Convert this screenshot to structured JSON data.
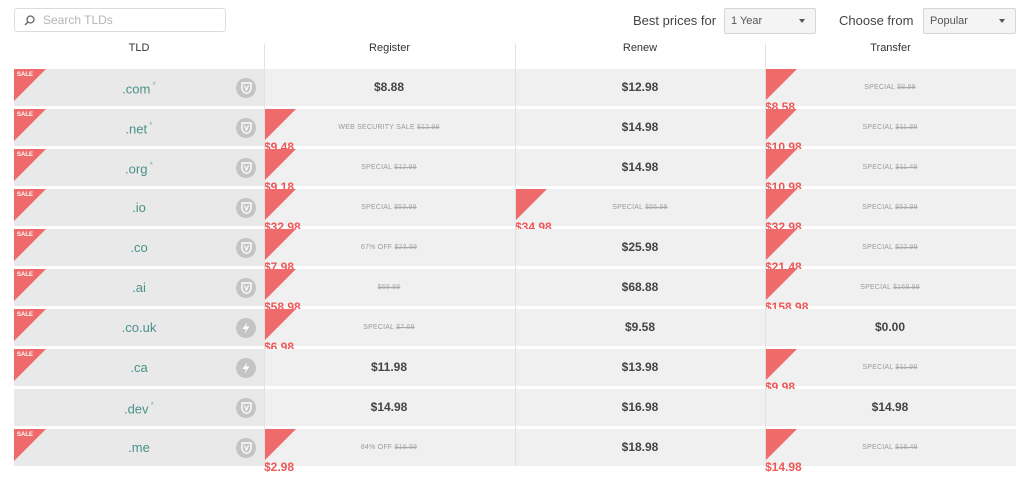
{
  "search": {
    "placeholder": "Search TLDs"
  },
  "controls": {
    "best_prices_label": "Best prices for",
    "term_value": "1 Year",
    "choose_from_label": "Choose from",
    "source_value": "Popular"
  },
  "table": {
    "headers": {
      "tld": "TLD",
      "register": "Register",
      "renew": "Renew",
      "transfer": "Transfer"
    },
    "sale_label": "SALE",
    "rows": [
      {
        "tld": ".com",
        "star": "*",
        "sale": true,
        "badge": "shield-icon",
        "register": {
          "price": "$8.88",
          "onsale": false
        },
        "renew": {
          "price": "$12.98",
          "onsale": false
        },
        "transfer": {
          "price": "$8.58",
          "onsale": true,
          "note": "SPECIAL",
          "old": "$8.88"
        }
      },
      {
        "tld": ".net",
        "star": "*",
        "sale": true,
        "badge": "shield-icon",
        "register": {
          "price": "$9.48",
          "onsale": true,
          "note": "WEB SECURITY SALE",
          "old": "$12.98"
        },
        "renew": {
          "price": "$14.98",
          "onsale": false
        },
        "transfer": {
          "price": "$10.98",
          "onsale": true,
          "note": "SPECIAL",
          "old": "$11.88"
        }
      },
      {
        "tld": ".org",
        "star": "*",
        "sale": true,
        "badge": "shield-icon",
        "register": {
          "price": "$9.18",
          "onsale": true,
          "note": "SPECIAL",
          "old": "$12.98"
        },
        "renew": {
          "price": "$14.98",
          "onsale": false
        },
        "transfer": {
          "price": "$10.98",
          "onsale": true,
          "note": "SPECIAL",
          "old": "$11.48"
        }
      },
      {
        "tld": ".io",
        "star": "",
        "sale": true,
        "badge": "shield-icon",
        "register": {
          "price": "$32.98",
          "onsale": true,
          "note": "SPECIAL",
          "old": "$53.98"
        },
        "renew": {
          "price": "$34.98",
          "onsale": true,
          "note": "SPECIAL",
          "old": "$55.98"
        },
        "transfer": {
          "price": "$32.98",
          "onsale": true,
          "note": "SPECIAL",
          "old": "$53.98"
        }
      },
      {
        "tld": ".co",
        "star": "",
        "sale": true,
        "badge": "shield-icon",
        "register": {
          "price": "$7.98",
          "onsale": true,
          "note": "67% OFF",
          "old": "$23.98"
        },
        "renew": {
          "price": "$25.98",
          "onsale": false
        },
        "transfer": {
          "price": "$21.48",
          "onsale": true,
          "note": "SPECIAL",
          "old": "$22.99"
        }
      },
      {
        "tld": ".ai",
        "star": "",
        "sale": true,
        "badge": "shield-icon",
        "register": {
          "price": "$58.98",
          "onsale": true,
          "note": "",
          "old": "$68.88"
        },
        "renew": {
          "price": "$68.88",
          "onsale": false
        },
        "transfer": {
          "price": "$158.98",
          "onsale": true,
          "note": "SPECIAL",
          "old": "$168.98"
        }
      },
      {
        "tld": ".co.uk",
        "star": "",
        "sale": true,
        "badge": "lightning-icon",
        "register": {
          "price": "$6.98",
          "onsale": true,
          "note": "SPECIAL",
          "old": "$7.68"
        },
        "renew": {
          "price": "$9.58",
          "onsale": false
        },
        "transfer": {
          "price": "$0.00",
          "onsale": false
        }
      },
      {
        "tld": ".ca",
        "star": "",
        "sale": true,
        "badge": "lightning-icon",
        "register": {
          "price": "$11.98",
          "onsale": false
        },
        "renew": {
          "price": "$13.98",
          "onsale": false
        },
        "transfer": {
          "price": "$9.98",
          "onsale": true,
          "note": "SPECIAL",
          "old": "$11.98"
        }
      },
      {
        "tld": ".dev",
        "star": "*",
        "sale": false,
        "badge": "shield-icon",
        "register": {
          "price": "$14.98",
          "onsale": false
        },
        "renew": {
          "price": "$16.98",
          "onsale": false
        },
        "transfer": {
          "price": "$14.98",
          "onsale": false
        }
      },
      {
        "tld": ".me",
        "star": "",
        "sale": true,
        "badge": "shield-icon",
        "register": {
          "price": "$2.98",
          "onsale": true,
          "note": "84% OFF",
          "old": "$18.98"
        },
        "renew": {
          "price": "$18.98",
          "onsale": false
        },
        "transfer": {
          "price": "$14.98",
          "onsale": true,
          "note": "SPECIAL",
          "old": "$18.48"
        }
      }
    ]
  },
  "colors": {
    "sale_red": "#ee5757",
    "tld_teal": "#4a9189",
    "row_bg": "#f0f0f0",
    "badge_grey": "#c4c4c4"
  }
}
